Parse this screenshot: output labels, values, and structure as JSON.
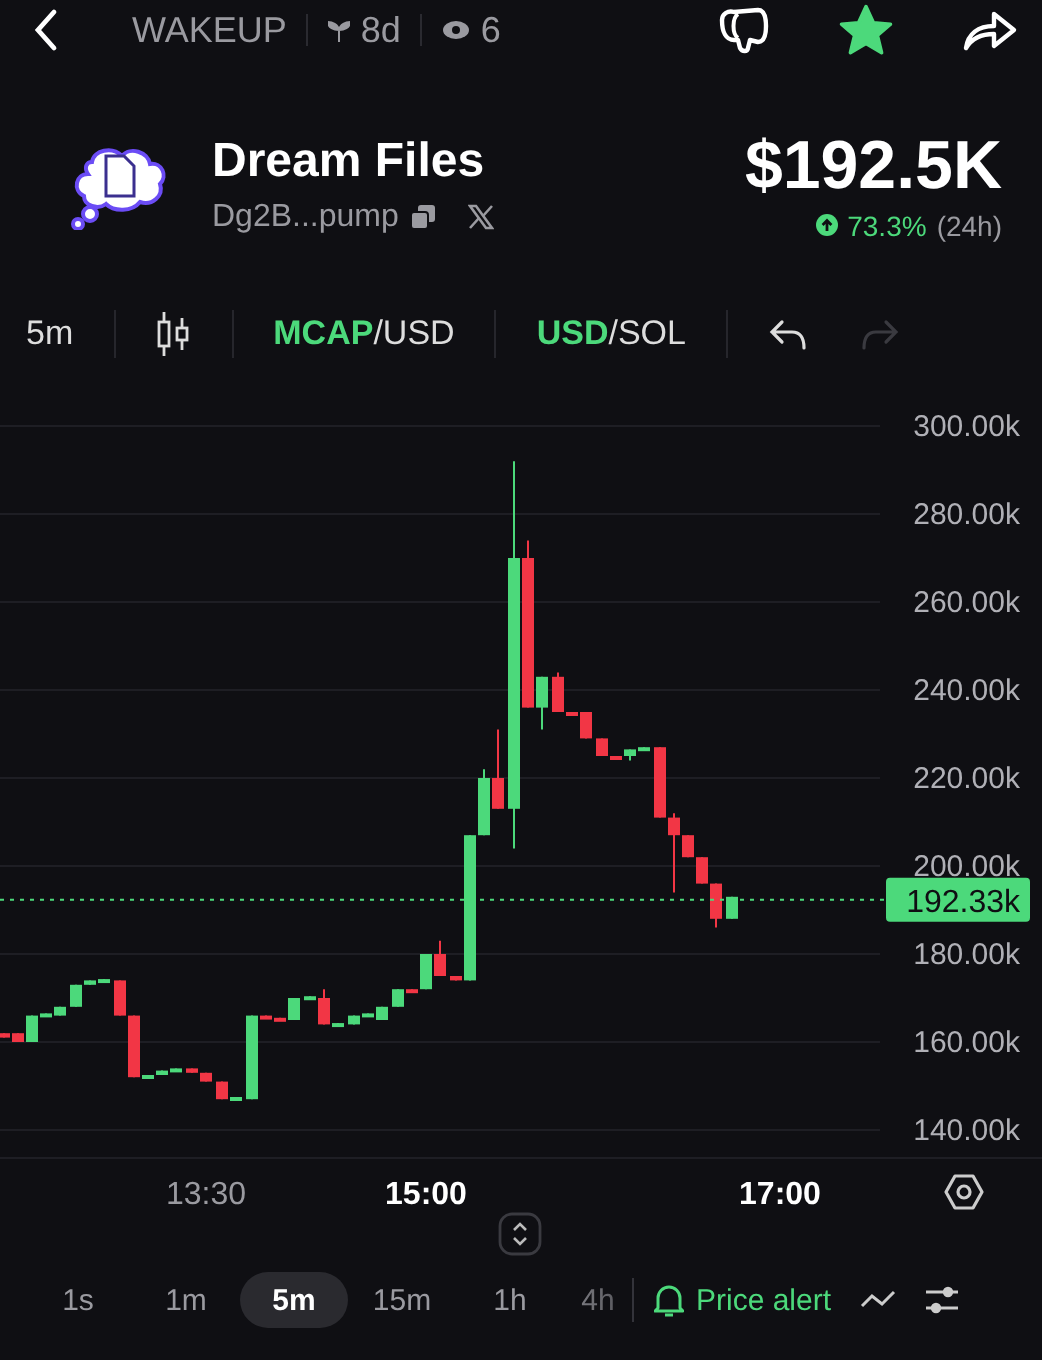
{
  "top_bar": {
    "ticker": "WAKEUP",
    "age": "8d",
    "watchers": "6",
    "favorite": true
  },
  "token": {
    "name": "Dream Files",
    "address": "Dg2B...pump",
    "market_cap": "$192.5K",
    "change": "73.3%",
    "change_period": "(24h)"
  },
  "toolbar": {
    "interval": "5m",
    "toggles": [
      {
        "separator": "/",
        "options": [
          {
            "label": "MCAP",
            "selected": true
          },
          {
            "label": "USD",
            "selected": false
          }
        ]
      },
      {
        "separator": "/",
        "options": [
          {
            "label": "USD",
            "selected": true
          },
          {
            "label": "SOL",
            "selected": false
          }
        ]
      }
    ],
    "undo": {
      "disabled": false
    },
    "redo": {
      "disabled": true
    }
  },
  "chart": {
    "y_labels": [
      "300.00k",
      "280.00k",
      "260.00k",
      "240.00k",
      "220.00k",
      "200.00k",
      "180.00k",
      "160.00k",
      "140.00k"
    ],
    "x_labels": [
      {
        "label": "13:30",
        "kind": "minor"
      },
      {
        "label": "15:00",
        "kind": "major"
      },
      {
        "label": "17:00",
        "kind": "major"
      }
    ],
    "current_price": "192.33k"
  },
  "intervals": [
    {
      "label": "1s",
      "selected": false
    },
    {
      "label": "1m",
      "selected": false
    },
    {
      "label": "5m",
      "selected": true
    },
    {
      "label": "15m",
      "selected": false
    },
    {
      "label": "1h",
      "selected": false
    },
    {
      "label": "4h",
      "selected": false
    }
  ],
  "price_alert": "Price alert"
}
